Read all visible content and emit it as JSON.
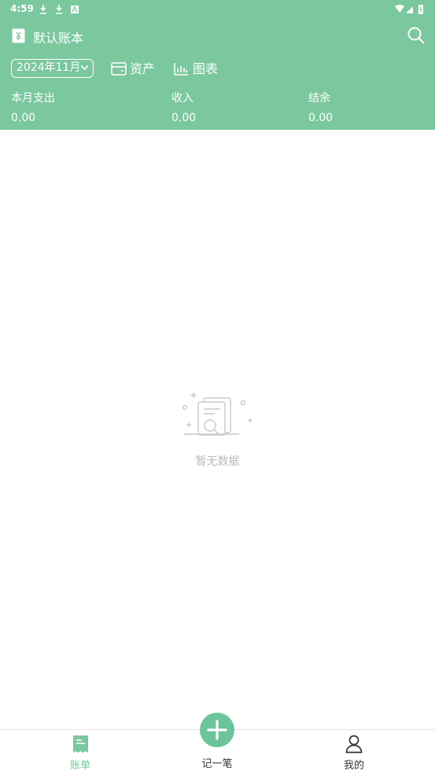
{
  "status_bar": {
    "time": "4:59"
  },
  "header": {
    "book_title": "默认账本",
    "month": "2024年11月",
    "assets_label": "资产",
    "charts_label": "图表"
  },
  "summary": {
    "expense_label": "本月支出",
    "expense_value": "0.00",
    "income_label": "收入",
    "income_value": "0.00",
    "balance_label": "结余",
    "balance_value": "0.00"
  },
  "empty_state": {
    "text": "暂无数据"
  },
  "tabbar": {
    "bills_label": "账单",
    "add_label": "记一笔",
    "mine_label": "我的"
  },
  "colors": {
    "primary": "#7bc89e",
    "fab": "#6cc59a",
    "active_tab": "#7bc89e",
    "inactive_text": "#333333",
    "empty_text": "#b9b9b9"
  }
}
